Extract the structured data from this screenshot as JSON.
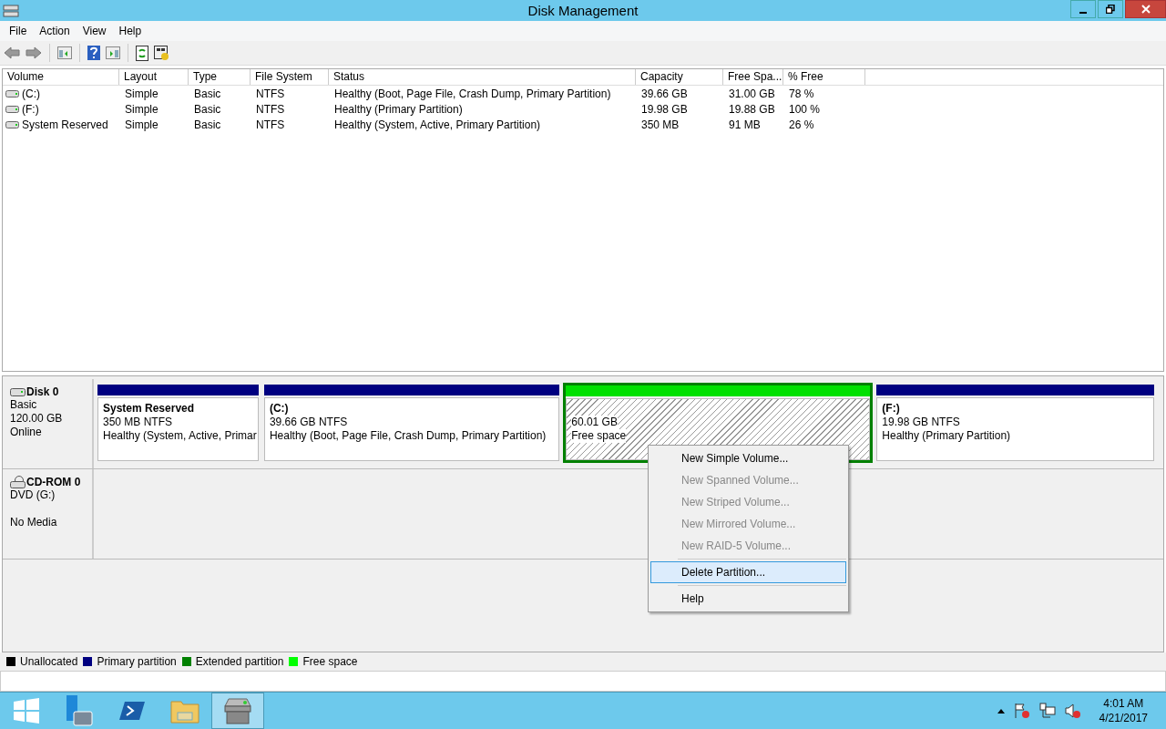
{
  "window": {
    "title": "Disk Management"
  },
  "menu": [
    "File",
    "Action",
    "View",
    "Help"
  ],
  "table": {
    "columns": [
      "Volume",
      "Layout",
      "Type",
      "File System",
      "Status",
      "Capacity",
      "Free Spa...",
      "% Free"
    ],
    "rows": [
      {
        "cells": [
          "(C:)",
          "Simple",
          "Basic",
          "NTFS",
          "Healthy (Boot, Page File, Crash Dump, Primary Partition)",
          "39.66 GB",
          "31.00 GB",
          "78 %"
        ]
      },
      {
        "cells": [
          "(F:)",
          "Simple",
          "Basic",
          "NTFS",
          "Healthy (Primary Partition)",
          "19.98 GB",
          "19.88 GB",
          "100 %"
        ]
      },
      {
        "cells": [
          "System Reserved",
          "Simple",
          "Basic",
          "NTFS",
          "Healthy (System, Active, Primary Partition)",
          "350 MB",
          "91 MB",
          "26 %"
        ]
      }
    ]
  },
  "disks": [
    {
      "kind": "disk",
      "name": "Disk 0",
      "lines": [
        "Basic",
        "120.00 GB",
        "Online"
      ],
      "partitions": [
        {
          "kind": "primary",
          "selected": false,
          "name": "System Reserved",
          "size": "350 MB NTFS",
          "status": "Healthy (System, Active, Primar"
        },
        {
          "kind": "primary",
          "selected": false,
          "name": "(C:)",
          "size": "39.66 GB NTFS",
          "status": "Healthy (Boot, Page File, Crash Dump, Primary Partition)"
        },
        {
          "kind": "free",
          "selected": true,
          "size": "60.01 GB",
          "status": "Free space"
        },
        {
          "kind": "primary",
          "selected": false,
          "name": "(F:)",
          "size": "19.98 GB NTFS",
          "status": "Healthy (Primary Partition)"
        }
      ]
    },
    {
      "kind": "cdrom",
      "name": "CD-ROM 0",
      "lines": [
        "DVD (G:)",
        "No Media"
      ]
    }
  ],
  "context_menu": [
    {
      "kind": "item",
      "label": "New Simple Volume...",
      "disabled": false,
      "selected": false
    },
    {
      "kind": "item",
      "label": "New Spanned Volume...",
      "disabled": true,
      "selected": false
    },
    {
      "kind": "item",
      "label": "New Striped Volume...",
      "disabled": true,
      "selected": false
    },
    {
      "kind": "item",
      "label": "New Mirrored Volume...",
      "disabled": true,
      "selected": false
    },
    {
      "kind": "item",
      "label": "New RAID-5 Volume...",
      "disabled": true,
      "selected": false
    },
    {
      "kind": "separator"
    },
    {
      "kind": "item",
      "label": "Delete Partition...",
      "disabled": false,
      "selected": true
    },
    {
      "kind": "separator"
    },
    {
      "kind": "item",
      "label": "Help",
      "disabled": false,
      "selected": false
    }
  ],
  "legend": [
    {
      "label": "Unallocated",
      "color": "#000000"
    },
    {
      "label": "Primary partition",
      "color": "#000080"
    },
    {
      "label": "Extended partition",
      "color": "#008000"
    },
    {
      "label": "Free space",
      "color": "#00ff00"
    }
  ],
  "taskbar": {
    "apps": [
      {
        "kind": "server",
        "selected": false
      },
      {
        "kind": "powershell",
        "selected": false
      },
      {
        "kind": "explorer",
        "selected": false
      },
      {
        "kind": "diskmgmt",
        "selected": true
      }
    ],
    "clock": {
      "time": "4:01 AM",
      "date": "4/21/2017"
    }
  }
}
